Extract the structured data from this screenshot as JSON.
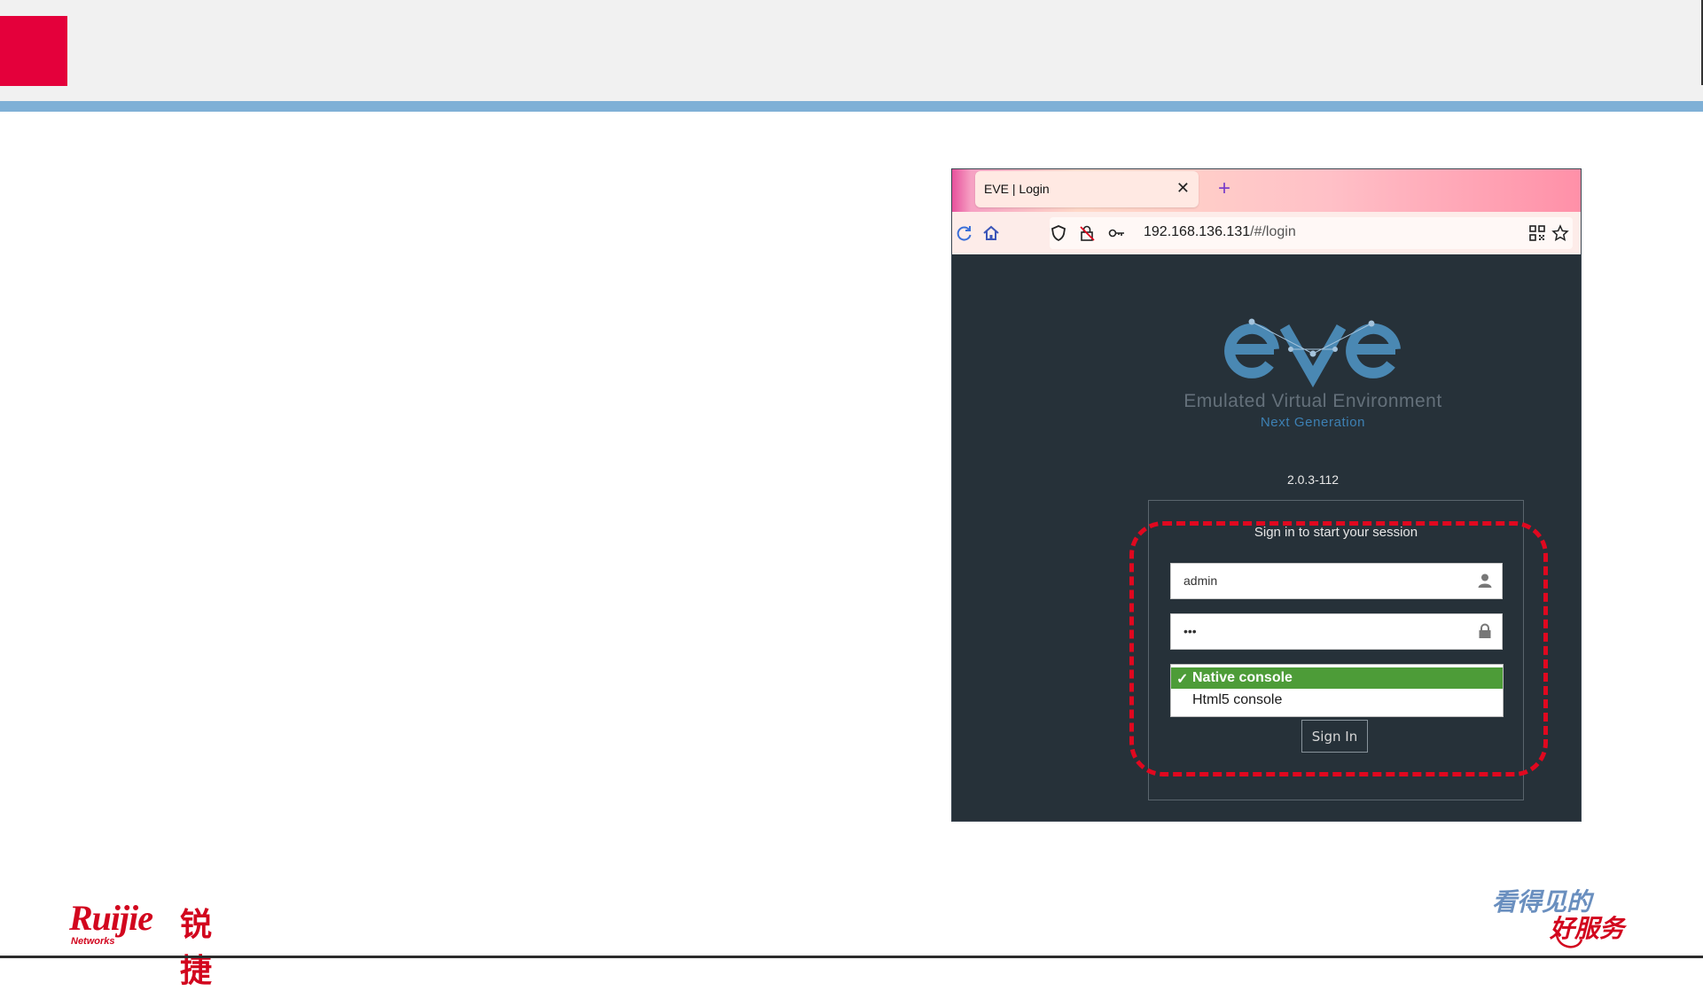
{
  "colors": {
    "accent_red": "#e4003b",
    "header_blue": "#7fb0d6",
    "select_green": "#4d9c38",
    "highlight_red": "#e0081f",
    "eve_blue": "#4a88b3"
  },
  "browser": {
    "tab_title": "EVE | Login",
    "tab_close_icon": "close-icon",
    "new_tab_icon": "plus-icon",
    "url_host": "192.168.136.131",
    "url_path": "/#/login",
    "icons": [
      "reload-icon",
      "home-icon",
      "shield-icon",
      "lock-slash-icon",
      "key-icon",
      "qr-code-icon",
      "star-icon"
    ]
  },
  "login": {
    "logo_text": "eve",
    "subtitle": "Emulated Virtual Environment",
    "tagline": "Next Generation",
    "version": "2.0.3-112",
    "message": "Sign in to start your session",
    "username_value": "admin",
    "password_value": "•••",
    "console_options": [
      {
        "label": "Native console",
        "selected": true,
        "check": "✓"
      },
      {
        "label": "Html5 console",
        "selected": false
      }
    ],
    "signin_label": "Sign In"
  },
  "footer": {
    "brand_latin": "Ruijie",
    "brand_cn": "锐捷",
    "brand_sub": "Networks",
    "slogan_line1": "看得见的",
    "slogan_line2": "好服务"
  }
}
